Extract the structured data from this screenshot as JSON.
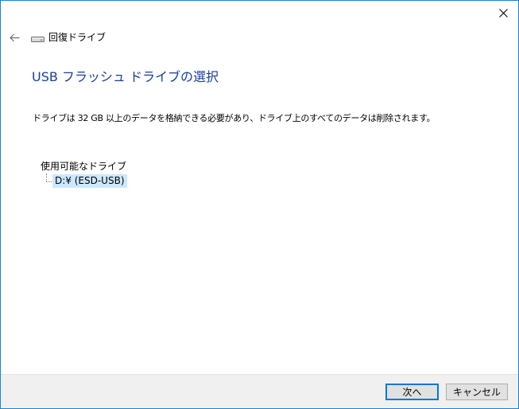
{
  "header": {
    "title": "回復ドライブ",
    "icons": {
      "back": "back-arrow-icon",
      "drive": "drive-icon",
      "close": "close-icon"
    }
  },
  "main": {
    "title": "USB フラッシュ ドライブの選択",
    "description": "ドライブは 32 GB 以上のデータを格納できる必要があり、ドライブ上のすべてのデータは削除されます。",
    "tree": {
      "root_label": "使用可能なドライブ",
      "items": [
        {
          "label": "D:¥ (ESD-USB)",
          "selected": true
        }
      ]
    }
  },
  "footer": {
    "next_label": "次へ",
    "cancel_label": "キャンセル"
  },
  "colors": {
    "window_border": "#1883d7",
    "title_blue": "#1a3e9a",
    "selection": "#cce8ff",
    "footer_bg": "#f0f0f0",
    "default_button_border": "#0078d7"
  }
}
